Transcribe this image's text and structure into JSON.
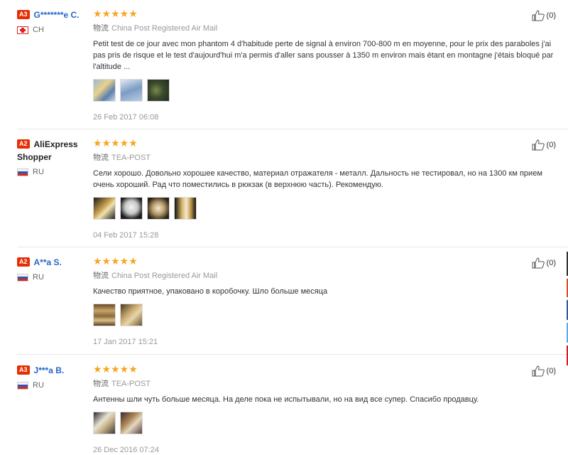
{
  "reviews": [
    {
      "badge": "A3",
      "user": "G*******e C.",
      "country": "CH",
      "flag": "ch",
      "stars": "★★★★★",
      "ship_cn": "物流",
      "shipping": "China Post Registered Air Mail",
      "text": "Petit test de ce jour avec mon phantom 4 d'habitude perte de signal à environ 700-800 m en moyenne, pour le prix des paraboles j'ai pas pris de risque et le test d'aujourd'hui m'a permis d'aller sans pousser à 1350 m environ mais étant en montagne j'étais bloqué par l'altitude ...",
      "photos": 3,
      "date": "26 Feb 2017 06:08",
      "helpful": "(0)"
    },
    {
      "badge": "A2",
      "user": "AliExpress Shopper",
      "country": "RU",
      "flag": "ru",
      "stars": "★★★★★",
      "ship_cn": "物流",
      "shipping": "TEA-POST",
      "text": "Сели хорошо. Довольно хорошее качество, материал отражателя - металл. Дальность не тестировал, но на 1300 км прием очень хороший. Рад что поместились в рюкзак (в верхнюю часть). Рекомендую.",
      "photos": 4,
      "date": "04 Feb 2017 15:28",
      "helpful": "(0)"
    },
    {
      "badge": "A2",
      "user": "A**a S.",
      "country": "RU",
      "flag": "ru",
      "stars": "★★★★★",
      "ship_cn": "物流",
      "shipping": "China Post Registered Air Mail",
      "text": "Качество приятное, упаковано в коробочку. Шло больше месяца",
      "photos": 2,
      "date": "17 Jan 2017 15:21",
      "helpful": "(0)"
    },
    {
      "badge": "A3",
      "user": "J***a B.",
      "country": "RU",
      "flag": "ru",
      "stars": "★★★★★",
      "ship_cn": "物流",
      "shipping": "TEA-POST",
      "text": "Антенны шли чуть больше месяца. На деле пока не испытывали, но на вид все супер. Спасибо продавцу.",
      "photos": 2,
      "date": "26 Dec 2016 07:24",
      "helpful": "(0)"
    }
  ],
  "colors": {
    "badge": "#e62e04",
    "username": "#2266cc",
    "stars": "#f5a623"
  }
}
